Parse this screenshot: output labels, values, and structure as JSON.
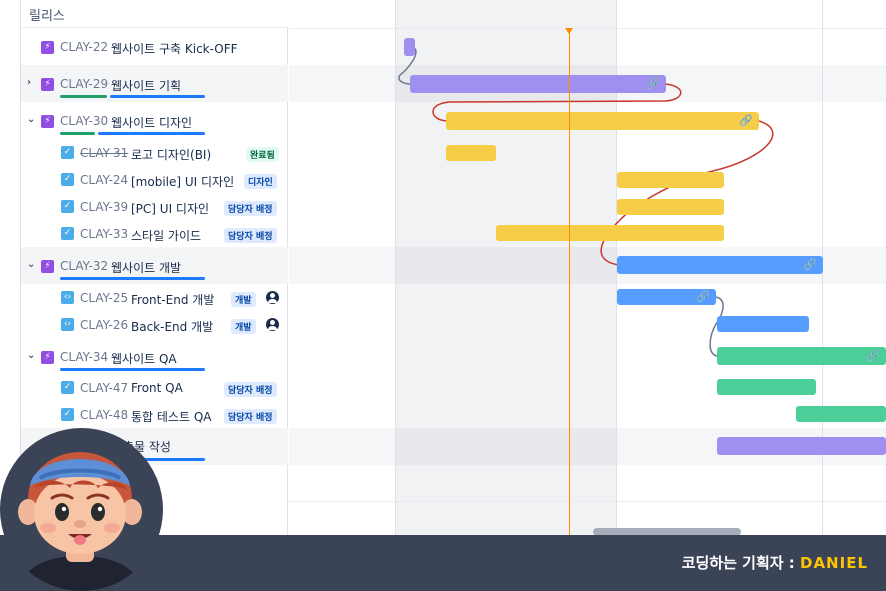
{
  "header": {
    "release_label": "릴리스"
  },
  "rows": [
    {
      "key": "CLAY-22",
      "title": "웹사이트 구축 Kick-OFF",
      "type": "epic"
    },
    {
      "key": "CLAY-29",
      "title": "웹사이트 기획",
      "type": "epic"
    },
    {
      "key": "CLAY-30",
      "title": "웹사이트 디자인",
      "type": "epic"
    },
    {
      "key": "CLAY-31",
      "title": "로고 디자인(BI)",
      "type": "task",
      "badge": "완료됨"
    },
    {
      "key": "CLAY-24",
      "title": "[mobile] UI 디자인",
      "type": "task",
      "badge": "디자인"
    },
    {
      "key": "CLAY-39",
      "title": "[PC] UI 디자인",
      "type": "task",
      "badge": "담당자 배정"
    },
    {
      "key": "CLAY-33",
      "title": "스타일 가이드",
      "type": "task",
      "badge": "담당자 배정"
    },
    {
      "key": "CLAY-32",
      "title": "웹사이트 개발",
      "type": "epic"
    },
    {
      "key": "CLAY-25",
      "title": "Front-End 개발",
      "type": "subtask",
      "badge": "개발"
    },
    {
      "key": "CLAY-26",
      "title": "Back-End 개발",
      "type": "subtask",
      "badge": "개발"
    },
    {
      "key": "CLAY-34",
      "title": "웹사이트 QA",
      "type": "epic"
    },
    {
      "key": "CLAY-47",
      "title": "Front QA",
      "type": "task",
      "badge": "담당자 배정"
    },
    {
      "key": "CLAY-48",
      "title": "통합 테스트 QA",
      "type": "task",
      "badge": "담당자 배정"
    },
    {
      "key": "",
      "title": "출물 작성",
      "type": "epic"
    }
  ],
  "icons": {
    "epic": "lightning-icon",
    "task": "checkbox-icon",
    "subtask": "subtask-icon",
    "link": "link-icon",
    "expand": "chevron-icon",
    "assignee": "avatar-icon"
  },
  "colors": {
    "epic_purple": "#9f8fef",
    "design_yellow": "#f5cd47",
    "dev_blue": "#579dff",
    "qa_green": "#4bce97",
    "dependency_red": "#c9372c",
    "today_orange": "#ff8b00",
    "footer_bg": "#3b4357",
    "footer_accent": "#ffc400"
  },
  "footer": {
    "label": "코딩하는 기획자 : ",
    "name": "DANIEL"
  }
}
